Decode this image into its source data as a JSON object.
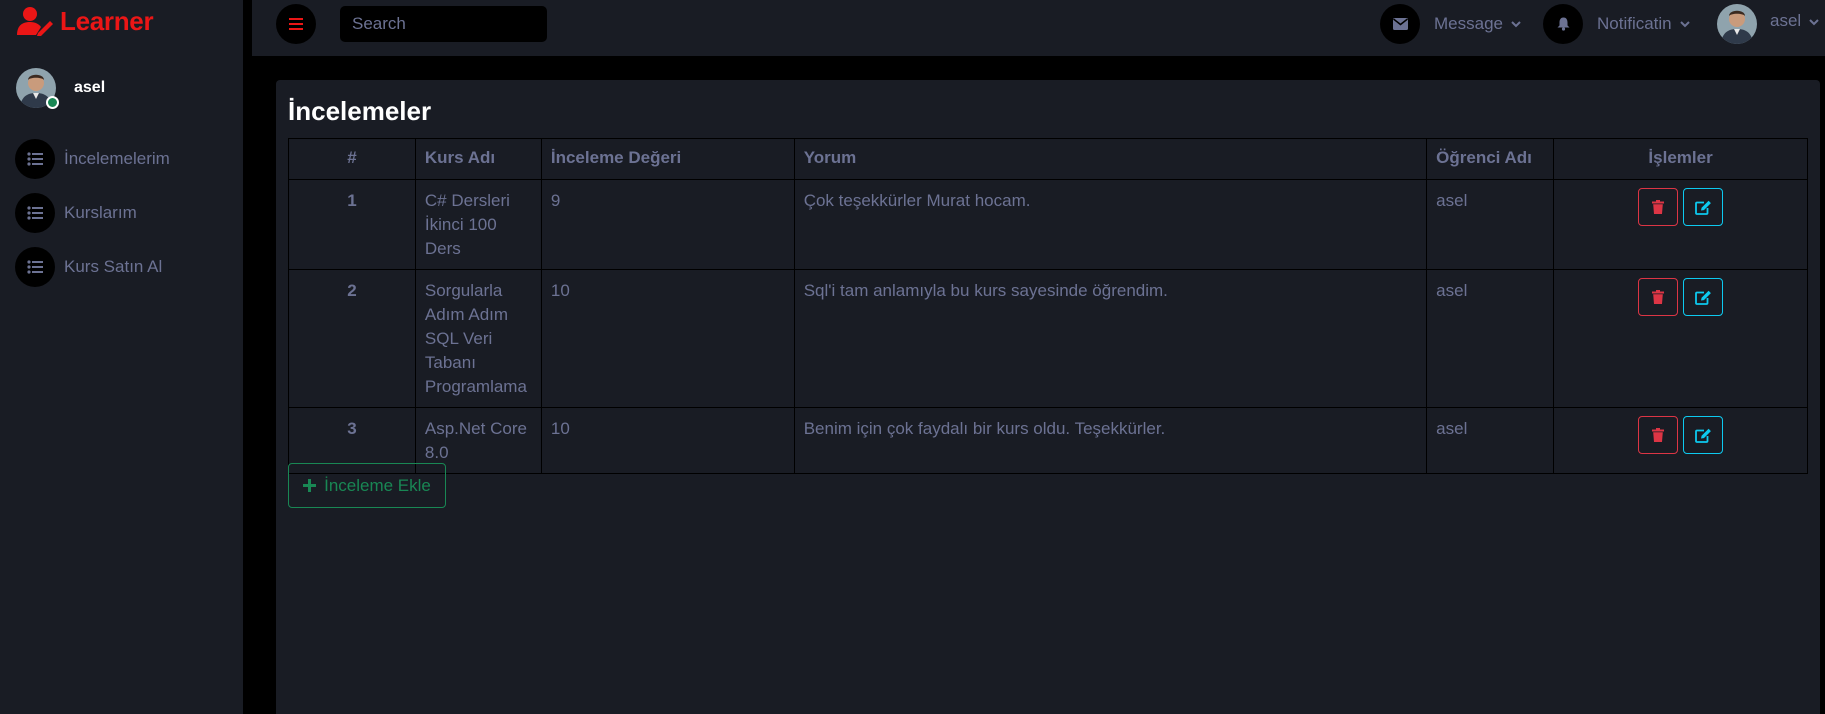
{
  "brand": {
    "name": "Learner",
    "accent": "#eb1616"
  },
  "sidebar": {
    "user": {
      "name": "asel",
      "status": "online"
    },
    "items": [
      {
        "label": "İncelemelerim",
        "icon": "list-icon"
      },
      {
        "label": "Kurslarım",
        "icon": "list-icon"
      },
      {
        "label": "Kurs Satın Al",
        "icon": "list-icon"
      }
    ]
  },
  "topbar": {
    "search_placeholder": "Search",
    "message_label": "Message",
    "notification_label": "Notificatin",
    "user_label": "asel"
  },
  "main": {
    "title": "İncelemeler",
    "table": {
      "headers": [
        "#",
        "Kurs Adı",
        "İnceleme Değeri",
        "Yorum",
        "Öğrenci Adı",
        "İşlemler"
      ],
      "rows": [
        {
          "id": "1",
          "course": "C# Dersleri İkinci 100 Ders",
          "score": "9",
          "comment": "Çok teşekkürler Murat hocam.",
          "student": "asel"
        },
        {
          "id": "2",
          "course": "Sorgularla Adım Adım SQL Veri Tabanı Programlama",
          "score": "10",
          "comment": "Sql'i tam anlamıyla bu kurs sayesinde öğrendim.",
          "student": "asel"
        },
        {
          "id": "3",
          "course": "Asp.Net Core 8.0",
          "score": "10",
          "comment": "Benim için çok faydalı bir kurs oldu. Teşekkürler.",
          "student": "asel"
        }
      ]
    },
    "add_button_label": "İnceleme Ekle"
  },
  "colors": {
    "background": "#000000",
    "panel": "#191c24",
    "text": "#6c7293",
    "danger": "#dc3545",
    "info": "#0dcaf0",
    "success": "#198754"
  }
}
